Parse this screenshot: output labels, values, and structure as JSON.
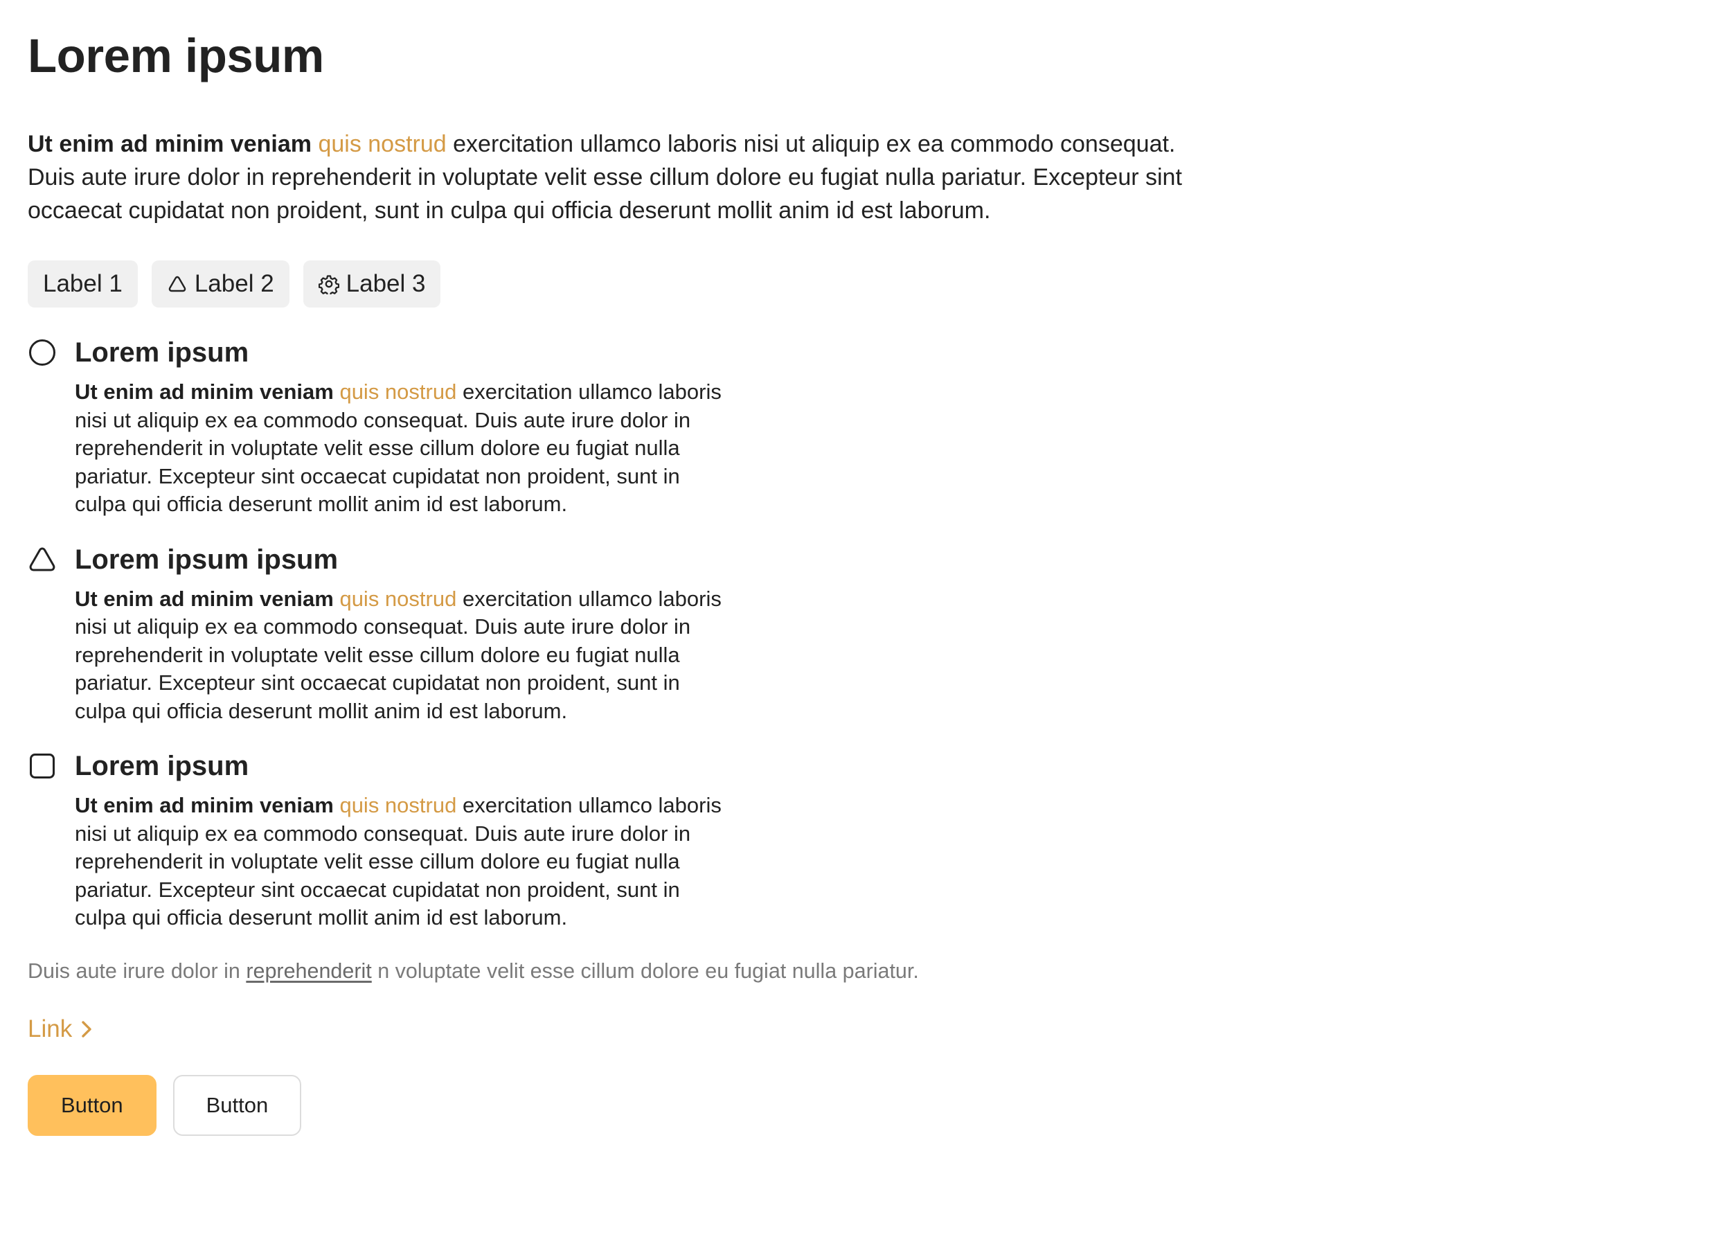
{
  "page": {
    "title": "Lorem ipsum"
  },
  "intro": {
    "bold": "Ut enim ad minim veniam",
    "accent": "quis nostrud",
    "rest": "exercitation ullamco laboris nisi ut aliquip ex ea commodo consequat. Duis aute irure dolor in reprehenderit in voluptate velit esse cillum dolore eu fugiat nulla pariatur. Excepteur sint occaecat cupidatat non proident, sunt in culpa qui officia deserunt mollit anim id est laborum."
  },
  "labels": [
    {
      "text": "Label 1",
      "icon": null
    },
    {
      "text": "Label 2",
      "icon": "triangle-icon"
    },
    {
      "text": "Label 3",
      "icon": "gear-icon"
    }
  ],
  "features": [
    {
      "icon": "circle-icon",
      "title": "Lorem ipsum",
      "bold": "Ut enim ad minim veniam",
      "accent": "quis nostrud",
      "rest": "exercitation ullamco laboris nisi ut aliquip ex ea commodo consequat. Duis aute irure dolor in reprehenderit in voluptate velit esse cillum dolore eu fugiat nulla pariatur. Excepteur sint occaecat cupidatat non proident, sunt in culpa qui officia deserunt mollit anim id est laborum."
    },
    {
      "icon": "triangle-icon",
      "title": "Lorem ipsum ipsum",
      "bold": "Ut enim ad minim veniam",
      "accent": "quis nostrud",
      "rest": "exercitation ullamco laboris nisi ut aliquip ex ea commodo consequat. Duis aute irure dolor in reprehenderit in voluptate velit esse cillum dolore eu fugiat nulla pariatur. Excepteur sint occaecat cupidatat non proident, sunt in culpa qui officia deserunt mollit anim id est laborum."
    },
    {
      "icon": "square-icon",
      "title": "Lorem ipsum",
      "bold": "Ut enim ad minim veniam",
      "accent": "quis nostrud",
      "rest": "exercitation ullamco laboris nisi ut aliquip ex ea commodo consequat. Duis aute irure dolor in reprehenderit in voluptate velit esse cillum dolore eu fugiat nulla pariatur. Excepteur sint occaecat cupidatat non proident, sunt in culpa qui officia deserunt mollit anim id est laborum."
    }
  ],
  "note": {
    "before": "Duis aute irure dolor in",
    "link": "reprehenderit",
    "after": "n voluptate velit esse cillum dolore eu fugiat nulla pariatur."
  },
  "link": {
    "label": "Link",
    "icon": "chevron-right-icon"
  },
  "buttons": {
    "primary_label": "Button",
    "secondary_label": "Button"
  },
  "colors": {
    "accent": "#d49a45",
    "primary_button": "#ffc05c",
    "chip_background": "#f0f0f0",
    "muted_text": "#7a7a7a"
  }
}
